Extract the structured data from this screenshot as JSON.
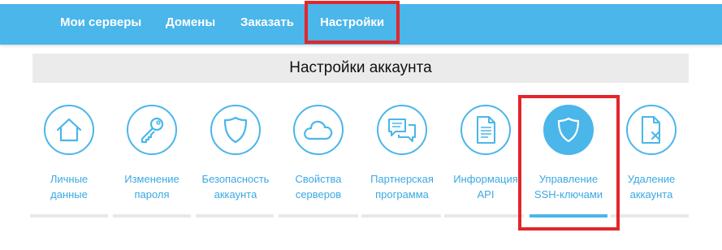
{
  "nav": {
    "items": [
      "Мои серверы",
      "Домены",
      "Заказать",
      "Настройки"
    ],
    "highlighted_index": 3
  },
  "page": {
    "section_title": "Настройки аккаунта"
  },
  "tiles": [
    {
      "icon": "home-icon",
      "line1": "Личные",
      "line2": "данные"
    },
    {
      "icon": "key-icon",
      "line1": "Изменение",
      "line2": "пароля"
    },
    {
      "icon": "shield-icon",
      "line1": "Безопасность",
      "line2": "аккаунта"
    },
    {
      "icon": "cloud-icon",
      "line1": "Свойства",
      "line2": "серверов"
    },
    {
      "icon": "chat-icon",
      "line1": "Партнерская",
      "line2": "программа"
    },
    {
      "icon": "document-icon",
      "line1": "Информация",
      "line2": "API"
    },
    {
      "icon": "shield-icon",
      "line1": "Управление",
      "line2": "SSH-ключами",
      "active": true
    },
    {
      "icon": "file-delete-icon",
      "line1": "Удаление",
      "line2": "аккаунта"
    }
  ],
  "colors": {
    "accent": "#4ab6ea",
    "label": "#3aa9e2",
    "highlight_box": "#e3262b",
    "header_bg": "#ebebeb"
  }
}
